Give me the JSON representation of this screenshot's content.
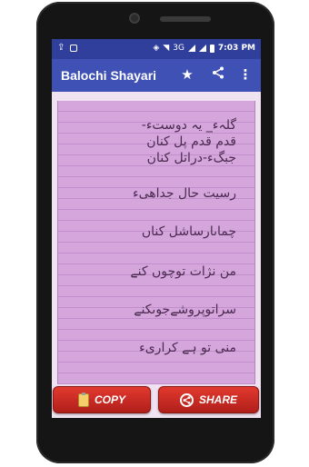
{
  "status_bar": {
    "time": "7:03 PM",
    "network": "3G",
    "icons": [
      "usb-icon",
      "notification-icon",
      "vibrate-icon",
      "wifi-icon",
      "signal-icon",
      "battery-icon"
    ]
  },
  "app_bar": {
    "title": "Balochi Shayari",
    "actions": [
      "star-icon",
      "share-icon",
      "more-vert-icon"
    ],
    "color": "#3f51b5"
  },
  "poem": {
    "lines": [
      "گلہء_ یہ دوستء-",
      "قدم قدم پل کنان",
      "جبگء-دراتل کنان",
      "رسیت حال جداهیء",
      "چماںارساشل کناں",
      "من نژات توچوں کنے",
      "سراتوپروشےجوںکنے",
      "منی تو ہے کراریء"
    ],
    "paper_color": "#d4a6dc"
  },
  "buttons": {
    "copy_label": "COPY",
    "share_label": "SHARE",
    "color": "#cc2a23"
  }
}
